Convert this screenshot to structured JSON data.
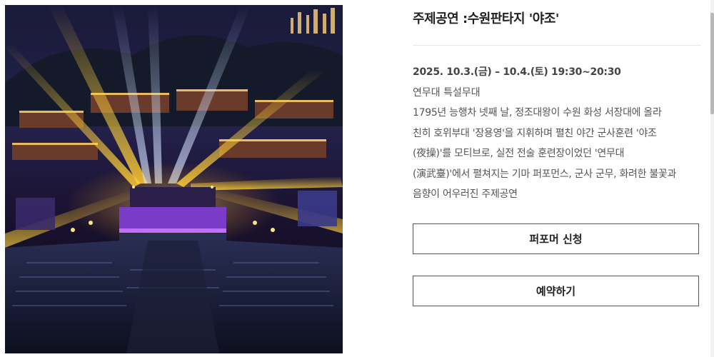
{
  "event": {
    "title": "주제공연 :수원판타지 '야조'",
    "date": "2025. 10.3.(금) – 10.4.(토) 19:30~20:30",
    "venue": "연무대 특설무대",
    "description_lines": [
      "1795년 능행차 넷째 날, 정조대왕이 수원 화성 서장대에 올라",
      "친히 호위부대 '장용영'을 지휘하며 펼친 야간 군사훈련 '야조",
      "(夜操)'를 모티브로, 실전 전술 훈련장이었던 '연무대",
      "(演武臺)'에서 펼쳐지는 기마 퍼포먼스, 군사 군무, 화려한 불꽃과",
      "음향이 어우러진 주제공연"
    ]
  },
  "buttons": {
    "performer_label": "퍼포머 신청",
    "reserve_label": "예약하기"
  },
  "colors": {
    "button_border": "#555555",
    "divider": "#e6e6e6",
    "title_text": "#222222",
    "body_text": "#555555"
  }
}
